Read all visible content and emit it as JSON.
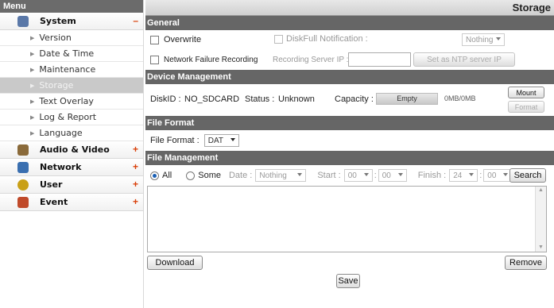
{
  "sidebar": {
    "header": "Menu",
    "categories": [
      {
        "label": "System",
        "toggle": "–",
        "icon": "system-icon",
        "color": "#5a78a8"
      },
      {
        "label": "Audio & Video",
        "toggle": "+",
        "icon": "audio-video-icon",
        "color": "#8a6a3a"
      },
      {
        "label": "Network",
        "toggle": "+",
        "icon": "network-icon",
        "color": "#3a6fb0"
      },
      {
        "label": "User",
        "toggle": "+",
        "icon": "user-icon",
        "color": "#c9a017"
      },
      {
        "label": "Event",
        "toggle": "+",
        "icon": "event-icon",
        "color": "#c04a2a"
      }
    ],
    "system_items": [
      {
        "label": "Version"
      },
      {
        "label": "Date & Time"
      },
      {
        "label": "Maintenance"
      },
      {
        "label": "Storage"
      },
      {
        "label": "Text Overlay"
      },
      {
        "label": "Log & Report"
      },
      {
        "label": "Language"
      }
    ],
    "active_item": "Storage"
  },
  "page": {
    "title": "Storage"
  },
  "general": {
    "header": "General",
    "overwrite": "Overwrite",
    "diskfull_notification": "DiskFull Notification :",
    "diskfull_select": "Nothing",
    "network_failure": "Network Failure Recording",
    "recording_server_ip": "Recording Server IP :",
    "recording_server_value": "",
    "set_ntp_button": "Set as NTP server IP"
  },
  "device": {
    "header": "Device Management",
    "diskid_label": "DiskID :",
    "diskid_value": "NO_SDCARD",
    "status_label": "Status :",
    "status_value": "Unknown",
    "capacity_label": "Capacity :",
    "capacity_bar_text": "Empty",
    "capacity_value": "0MB/0MB",
    "mount_button": "Mount",
    "format_button": "Format"
  },
  "file_format": {
    "header": "File Format",
    "label": "File Format :",
    "value": "DAT"
  },
  "file_management": {
    "header": "File Management",
    "all_label": "All",
    "some_label": "Some",
    "date_label": "Date :",
    "date_value": "Nothing",
    "start_label": "Start :",
    "start_hour": "00",
    "start_min": "00",
    "finish_label": "Finish :",
    "finish_hour": "24",
    "finish_min": "00",
    "search_button": "Search",
    "download_button": "Download",
    "remove_button": "Remove",
    "save_button": "Save",
    "separator": ":"
  }
}
